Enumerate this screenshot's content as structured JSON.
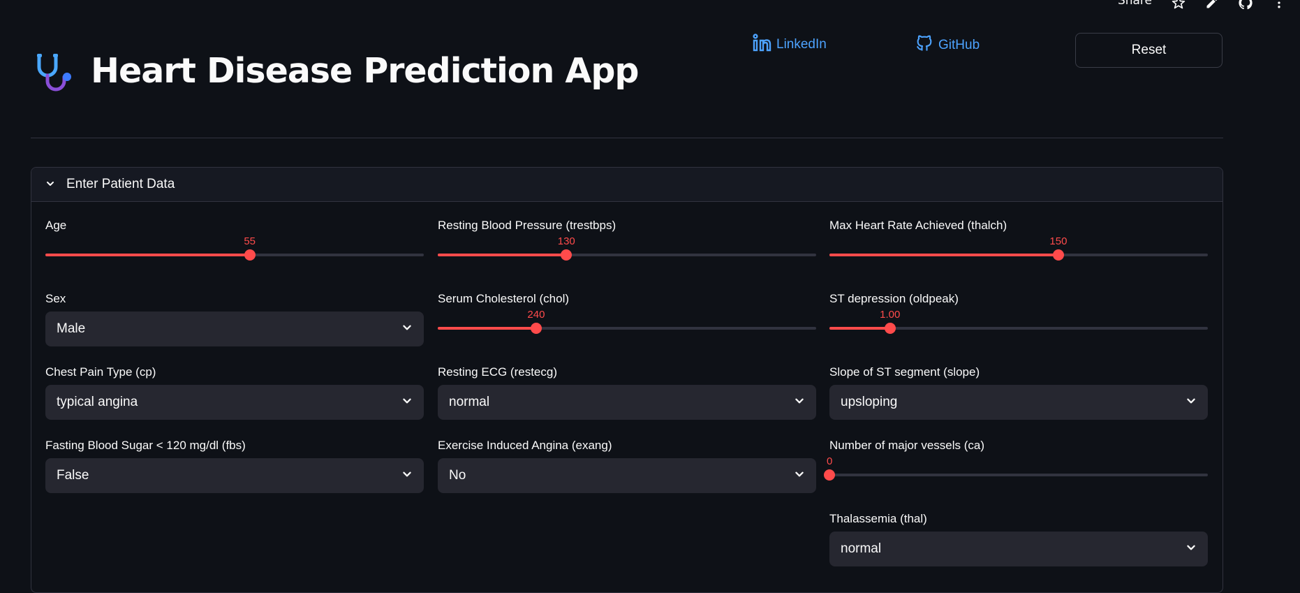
{
  "toolbar": {
    "share_label": "Share",
    "icons": [
      "star-icon",
      "pencil-icon",
      "github-icon",
      "more-vertical-icon"
    ]
  },
  "header": {
    "title": "Heart Disease Prediction App",
    "icon": "stethoscope-icon",
    "linkedin_label": "LinkedIn",
    "github_label": "GitHub",
    "reset_label": "Reset"
  },
  "colors": {
    "accent": "#ff4b4b",
    "link": "#4da3ff",
    "background": "#0e1117",
    "input_bg": "#262730"
  },
  "expander": {
    "title": "Enter Patient Data",
    "expanded": true,
    "fields": {
      "age": {
        "label": "Age",
        "display": "55",
        "fraction": 0.54
      },
      "sex": {
        "label": "Sex",
        "value": "Male"
      },
      "cp": {
        "label": "Chest Pain Type (cp)",
        "value": "typical angina"
      },
      "fbs": {
        "label": "Fasting Blood Sugar < 120 mg/dl (fbs)",
        "value": "False"
      },
      "trestbps": {
        "label": "Resting Blood Pressure (trestbps)",
        "display": "130",
        "fraction": 0.34
      },
      "chol": {
        "label": "Serum Cholesterol (chol)",
        "display": "240",
        "fraction": 0.26
      },
      "restecg": {
        "label": "Resting ECG (restecg)",
        "value": "normal"
      },
      "exang": {
        "label": "Exercise Induced Angina (exang)",
        "value": "No"
      },
      "thalch": {
        "label": "Max Heart Rate Achieved (thalch)",
        "display": "150",
        "fraction": 0.605
      },
      "oldpeak": {
        "label": "ST depression (oldpeak)",
        "display": "1.00",
        "fraction": 0.16
      },
      "slope": {
        "label": "Slope of ST segment (slope)",
        "value": "upsloping"
      },
      "ca": {
        "label": "Number of major vessels (ca)",
        "display": "0",
        "fraction": 0.0
      },
      "thal": {
        "label": "Thalassemia (thal)",
        "value": "normal"
      }
    }
  }
}
